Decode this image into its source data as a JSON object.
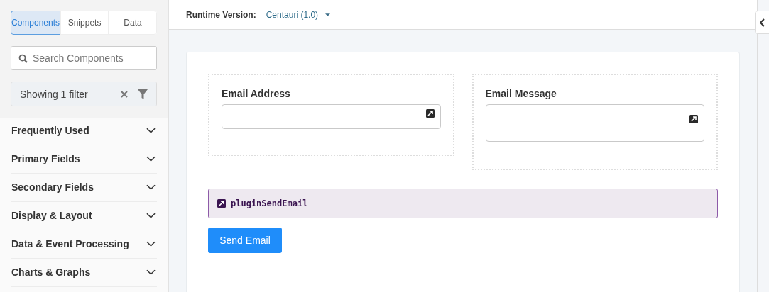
{
  "sidebar": {
    "tabs": [
      {
        "label": "Components",
        "selected": true
      },
      {
        "label": "Snippets",
        "selected": false
      },
      {
        "label": "Data",
        "selected": false
      }
    ],
    "search": {
      "placeholder": "Search Components"
    },
    "filter": {
      "label": "Showing 1 filter"
    },
    "sections": [
      {
        "label": "Frequently Used",
        "expanded": false
      },
      {
        "label": "Primary Fields",
        "expanded": false
      },
      {
        "label": "Secondary Fields",
        "expanded": false
      },
      {
        "label": "Display & Layout",
        "expanded": false
      },
      {
        "label": "Data & Event Processing",
        "expanded": false
      },
      {
        "label": "Charts & Graphs",
        "expanded": false
      }
    ]
  },
  "header": {
    "label": "Runtime Version:",
    "version": "Centauri (1.0)"
  },
  "form": {
    "fields": [
      {
        "label": "Email Address",
        "kind": "input"
      },
      {
        "label": "Email Message",
        "kind": "textarea"
      }
    ],
    "plugin": {
      "name": "pluginSendEmail"
    },
    "button": {
      "label": "Send Email"
    }
  }
}
